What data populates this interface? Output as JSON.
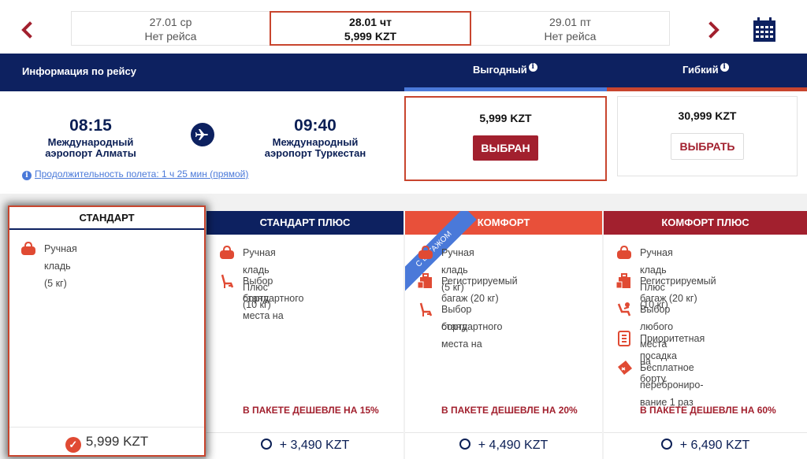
{
  "dates": {
    "prev": {
      "date": "27.01 ср",
      "status": "Нет рейса"
    },
    "active": {
      "date": "28.01 чт",
      "price": "5,999 KZT"
    },
    "next": {
      "date": "29.01 пт",
      "status": "Нет рейса"
    }
  },
  "header": {
    "info_title": "Информация по рейсу",
    "tab_vygodny": "Выгодный",
    "tab_gibky": "Гибкий",
    "info_icon": "i"
  },
  "flight": {
    "dep_time": "08:15",
    "dep_airport_1": "Международный",
    "dep_airport_2": "аэропорт Алматы",
    "arr_time": "09:40",
    "arr_airport_1": "Международный",
    "arr_airport_2": "аэропорт Туркестан",
    "duration": "Продолжительность полета: 1 ч 25 мин (прямой)"
  },
  "fares": {
    "vygodny": {
      "price": "5,999 KZT",
      "button": "ВЫБРАН"
    },
    "gibky": {
      "price": "30,999 KZT",
      "button": "ВЫБРАТЬ"
    }
  },
  "packages": [
    {
      "title": "СТАНДАРТ",
      "features": [
        "Ручная кладь (5 кг)"
      ],
      "price": "5,999 KZT",
      "check": "✓"
    },
    {
      "title": "СТАНДАРТ ПЛЮС",
      "features": [
        "Ручная кладь Плюс (10 кг)",
        "Выбор стандартного места на",
        "борту"
      ],
      "cheaper": "В ПАКЕТЕ ДЕШЕВЛЕ НА 15%",
      "price": "+ 3,490 KZT"
    },
    {
      "title": "КОМФОРТ",
      "ribbon": "С БАГАЖОМ",
      "features": [
        "Ручная кладь (5 кг)",
        "Регистрируемый багаж (20 кг)",
        "Выбор стандартного места на",
        "борту"
      ],
      "cheaper": "В ПАКЕТЕ ДЕШЕВЛЕ НА 20%",
      "price": "+ 4,490 KZT"
    },
    {
      "title": "КОМФОРТ ПЛЮС",
      "features": [
        "Ручная кладь Плюс (10 кг)",
        "Регистрируемый багаж (20 кг)",
        "Выбор любого места на борту",
        "Приоритетная посадка",
        "Бесплатное",
        "переброниро­вание 1 раз"
      ],
      "cheaper": "В ПАКЕТЕ ДЕШЕВЛЕ НА 60%",
      "price": "+ 6,490 KZT"
    }
  ],
  "colors": {
    "navy": "#0d2160",
    "accent_red": "#c8452e",
    "dark_red": "#a2202e",
    "blue": "#4a79d9",
    "orange": "#e8503a"
  }
}
